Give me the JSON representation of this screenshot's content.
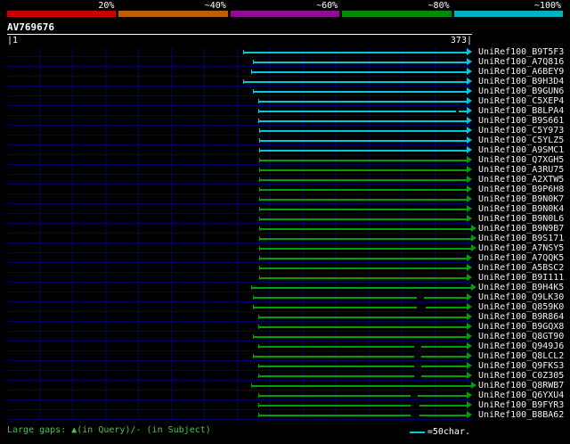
{
  "scale": {
    "segments": [
      {
        "label": "20%",
        "color": "#c80000"
      },
      {
        "label": "~40%",
        "color": "#bd5f00"
      },
      {
        "label": "~60%",
        "color": "#8c0f8c"
      },
      {
        "label": "~80%",
        "color": "#008a0a"
      },
      {
        "label": "~100%",
        "color": "#00b0c0"
      }
    ]
  },
  "query": {
    "name": "AV769676",
    "ruler_start": "|1",
    "ruler_end": "373|",
    "length": 373
  },
  "footer": {
    "gaps_note": "Large gaps: ▲(in Query)/- (in Subject)",
    "scale_legend": "=50char."
  },
  "chart_data": {
    "type": "bar",
    "orientation": "horizontal",
    "title": "AV769676",
    "xlabel": "",
    "x_range": [
      1,
      373
    ],
    "grid": true,
    "colors": {
      "cyan": "#00c8dc",
      "green": "#00a000"
    },
    "rows": [
      {
        "label": "UniRef100_B9T5F3",
        "color": "cyan",
        "start": 190,
        "end": 373
      },
      {
        "label": "UniRef100_A7Q816",
        "color": "cyan",
        "start": 198,
        "end": 373
      },
      {
        "label": "UniRef100_A6BEY9",
        "color": "cyan",
        "start": 196,
        "end": 373
      },
      {
        "label": "UniRef100_B9H3D4",
        "color": "cyan",
        "start": 190,
        "end": 373
      },
      {
        "label": "UniRef100_B9GUN6",
        "color": "cyan",
        "start": 198,
        "end": 373
      },
      {
        "label": "UniRef100_C5XEP4",
        "color": "cyan",
        "start": 202,
        "end": 373
      },
      {
        "label": "UniRef100_B8LPA4",
        "color": "cyan",
        "start": 202,
        "end": 373,
        "gaps": [
          {
            "pos": 360,
            "len": 2
          }
        ]
      },
      {
        "label": "UniRef100_B9S661",
        "color": "cyan",
        "start": 202,
        "end": 373
      },
      {
        "label": "UniRef100_C5Y973",
        "color": "cyan",
        "start": 203,
        "end": 373
      },
      {
        "label": "UniRef100_C5YLZ5",
        "color": "cyan",
        "start": 203,
        "end": 373
      },
      {
        "label": "UniRef100_A9SMC1",
        "color": "cyan",
        "start": 203,
        "end": 373
      },
      {
        "label": "UniRef100_Q7XGH5",
        "color": "green",
        "start": 203,
        "end": 373
      },
      {
        "label": "UniRef100_A3RU75",
        "color": "green",
        "start": 203,
        "end": 373
      },
      {
        "label": "UniRef100_A2XTW5",
        "color": "green",
        "start": 203,
        "end": 373
      },
      {
        "label": "UniRef100_B9P6H8",
        "color": "green",
        "start": 203,
        "end": 373
      },
      {
        "label": "UniRef100_B9N0K7",
        "color": "green",
        "start": 203,
        "end": 373
      },
      {
        "label": "UniRef100_B9N0K4",
        "color": "green",
        "start": 203,
        "end": 373
      },
      {
        "label": "UniRef100_B9N0L6",
        "color": "green",
        "start": 203,
        "end": 373
      },
      {
        "label": "UniRef100_B9N9B7",
        "color": "green",
        "start": 203,
        "end": 373,
        "overshoot": true
      },
      {
        "label": "UniRef100_B9S171",
        "color": "green",
        "start": 203,
        "end": 373,
        "overshoot": true
      },
      {
        "label": "UniRef100_A7NSY5",
        "color": "green",
        "start": 203,
        "end": 373,
        "overshoot": true
      },
      {
        "label": "UniRef100_A7QQK5",
        "color": "green",
        "start": 203,
        "end": 373
      },
      {
        "label": "UniRef100_A5BSC2",
        "color": "green",
        "start": 203,
        "end": 373
      },
      {
        "label": "UniRef100_B9I111",
        "color": "green",
        "start": 203,
        "end": 373
      },
      {
        "label": "UniRef100_B9H4K5",
        "color": "green",
        "start": 196,
        "end": 373,
        "overshoot": true
      },
      {
        "label": "UniRef100_Q9LK30",
        "color": "green",
        "start": 198,
        "end": 373,
        "gaps": [
          {
            "pos": 329,
            "len": 6
          }
        ]
      },
      {
        "label": "UniRef100_Q859K0",
        "color": "green",
        "start": 198,
        "end": 373,
        "gaps": [
          {
            "pos": 329,
            "len": 7
          }
        ]
      },
      {
        "label": "UniRef100_B9R864",
        "color": "green",
        "start": 202,
        "end": 373
      },
      {
        "label": "UniRef100_B9GQX8",
        "color": "green",
        "start": 202,
        "end": 373
      },
      {
        "label": "UniRef100_Q8GT90",
        "color": "green",
        "start": 198,
        "end": 373
      },
      {
        "label": "UniRef100_Q949J6",
        "color": "green",
        "start": 202,
        "end": 373,
        "gaps": [
          {
            "pos": 327,
            "len": 6
          }
        ]
      },
      {
        "label": "UniRef100_Q8LCL2",
        "color": "green",
        "start": 198,
        "end": 373,
        "gaps": [
          {
            "pos": 327,
            "len": 6
          }
        ]
      },
      {
        "label": "UniRef100_Q9FKS3",
        "color": "green",
        "start": 202,
        "end": 373,
        "gaps": [
          {
            "pos": 327,
            "len": 6
          }
        ]
      },
      {
        "label": "UniRef100_C0Z305",
        "color": "green",
        "start": 202,
        "end": 373,
        "gaps": [
          {
            "pos": 327,
            "len": 6
          }
        ]
      },
      {
        "label": "UniRef100_Q8RWB7",
        "color": "green",
        "start": 196,
        "end": 373,
        "overshoot": true
      },
      {
        "label": "UniRef100_Q6YXU4",
        "color": "green",
        "start": 202,
        "end": 373,
        "gaps": [
          {
            "pos": 324,
            "len": 6
          }
        ]
      },
      {
        "label": "UniRef100_B9FYR3",
        "color": "green",
        "start": 202,
        "end": 373,
        "gaps": [
          {
            "pos": 324,
            "len": 7
          }
        ]
      },
      {
        "label": "UniRef100_B8BA62",
        "color": "green",
        "start": 202,
        "end": 373,
        "gaps": [
          {
            "pos": 324,
            "len": 7
          }
        ]
      }
    ]
  }
}
